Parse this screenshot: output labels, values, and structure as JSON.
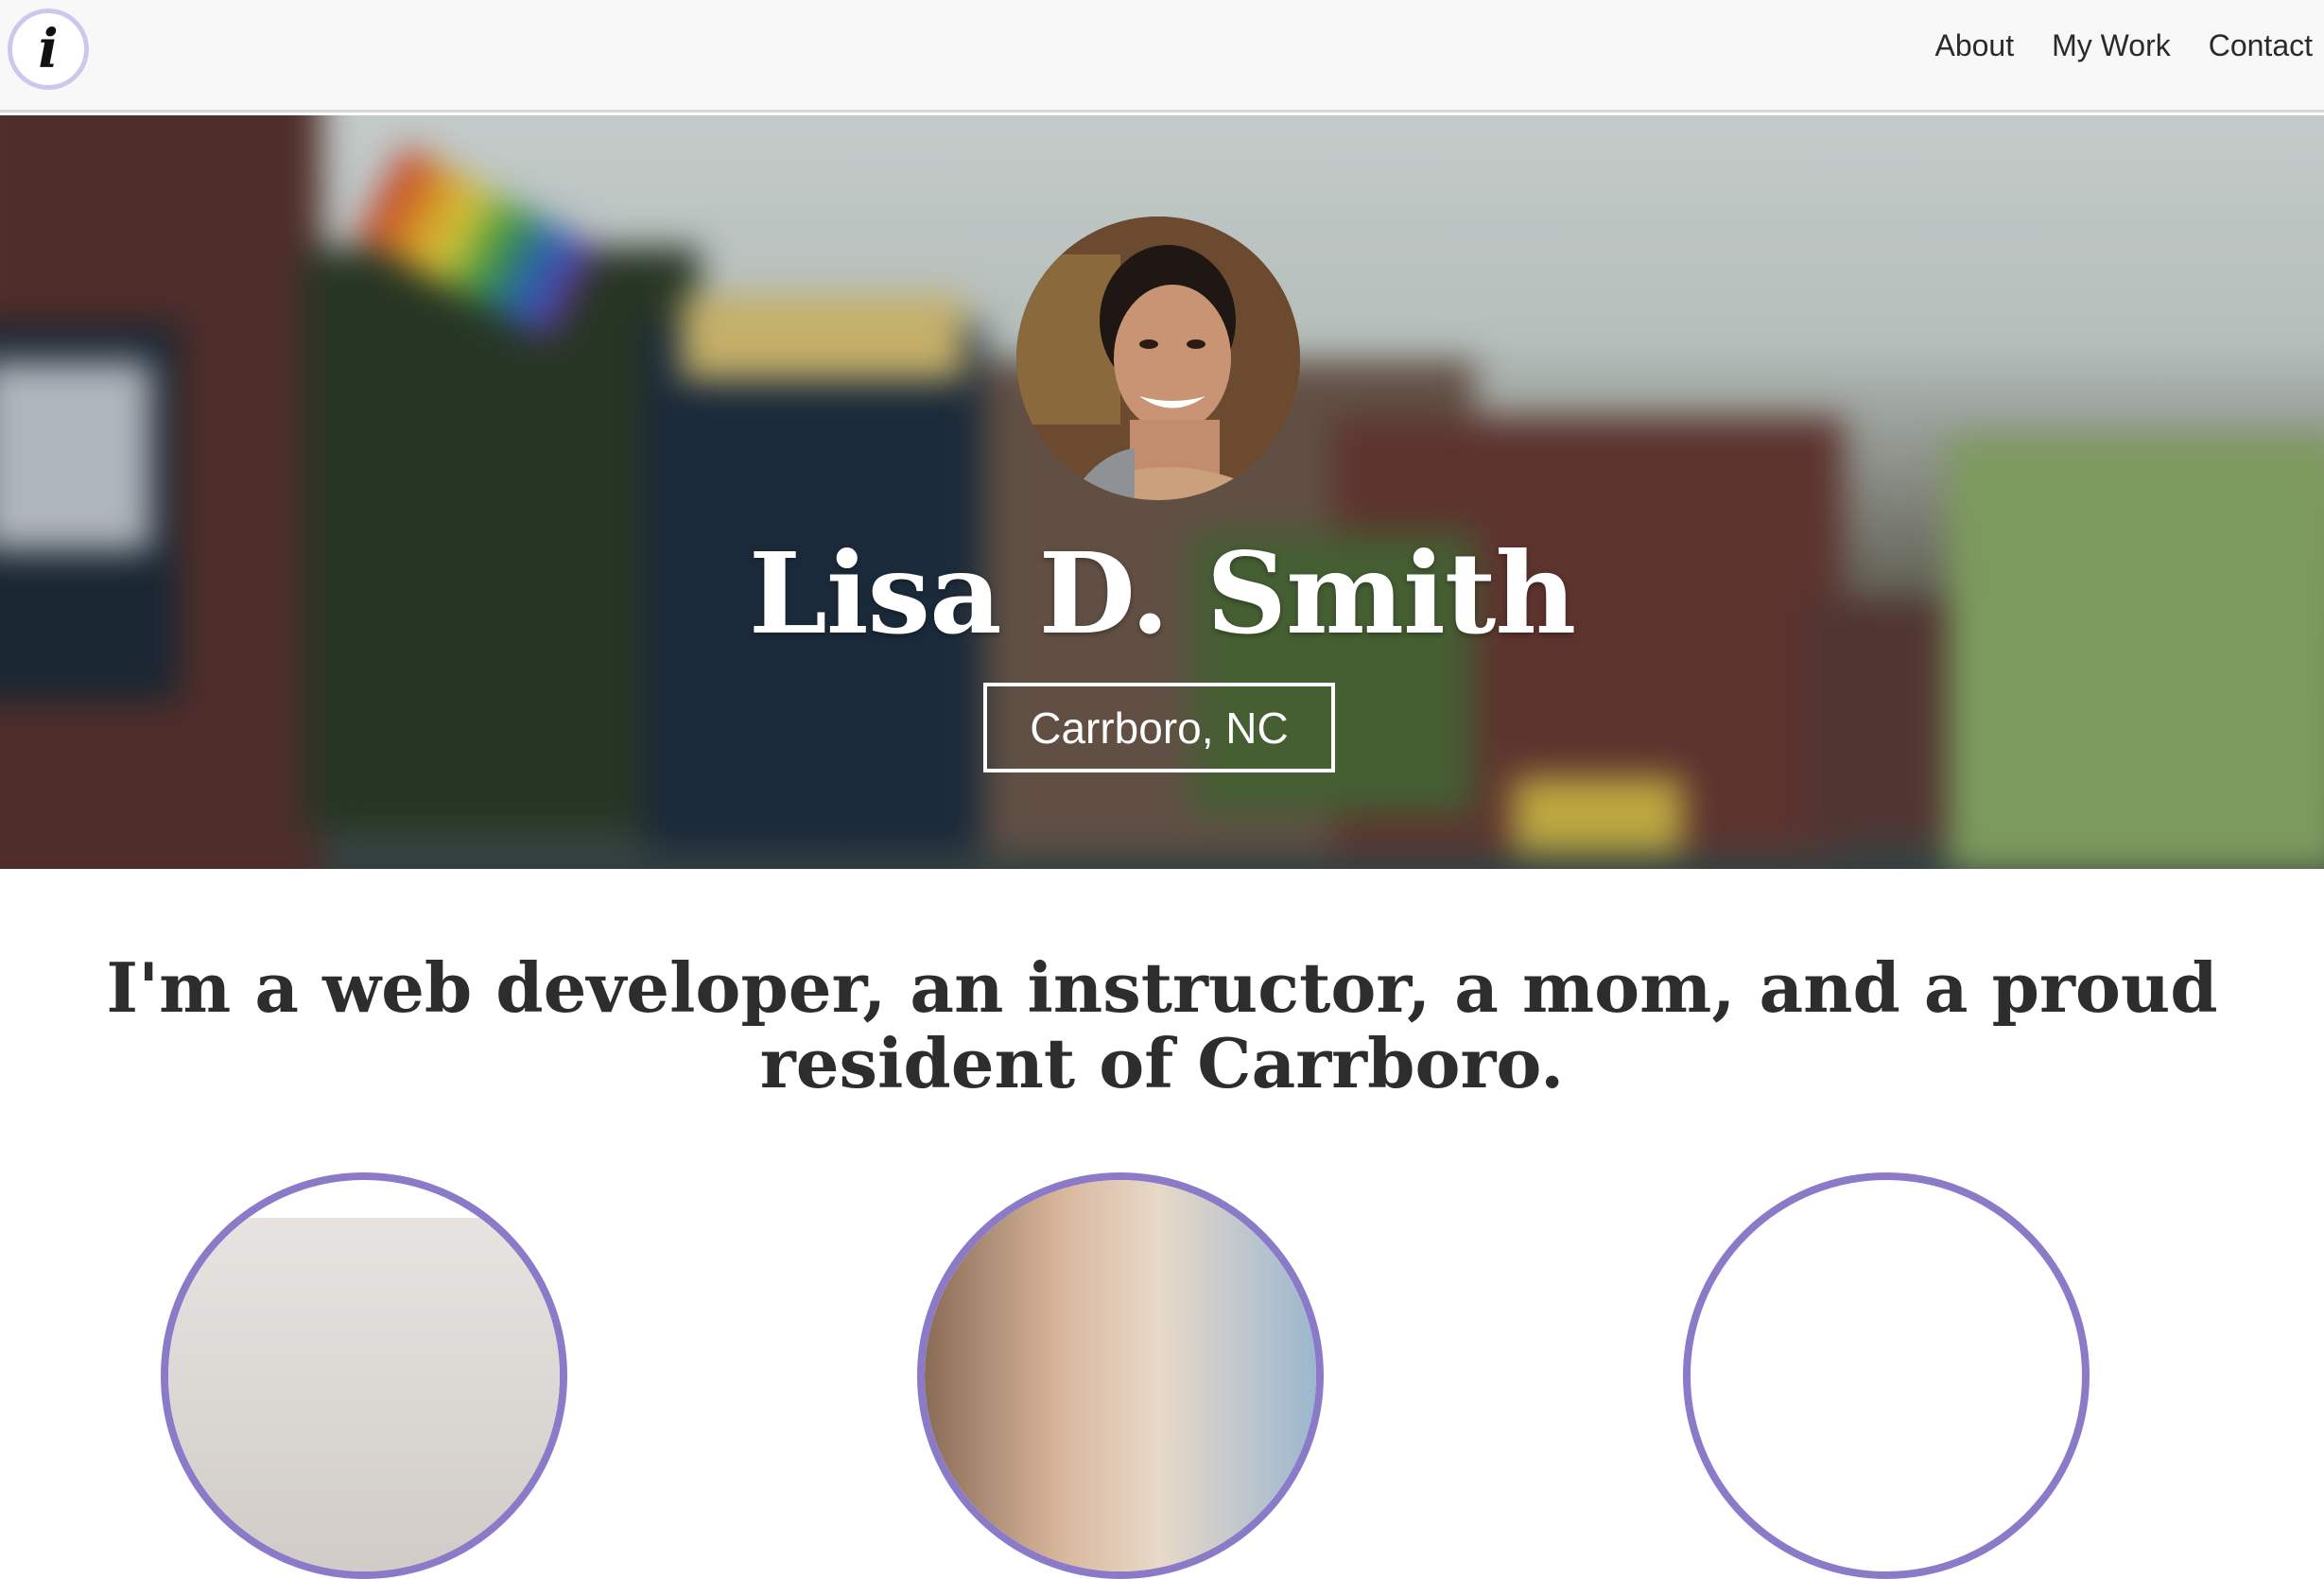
{
  "nav": {
    "logo_letter": "i",
    "links": [
      "About",
      "My Work",
      "Contact"
    ]
  },
  "hero": {
    "name": "Lisa D. Smith",
    "location": "Carrboro, NC"
  },
  "intro": {
    "text": "I'm a web developer, an instructor, a mom, and a proud resident of Carrboro."
  },
  "colors": {
    "accent": "#8b7ac8",
    "logo_ring": "#cfc6ee",
    "navbar_bg": "#f8f8f8",
    "heading_text": "#2d2d2d"
  },
  "icons": {
    "logo": "info-icon"
  }
}
